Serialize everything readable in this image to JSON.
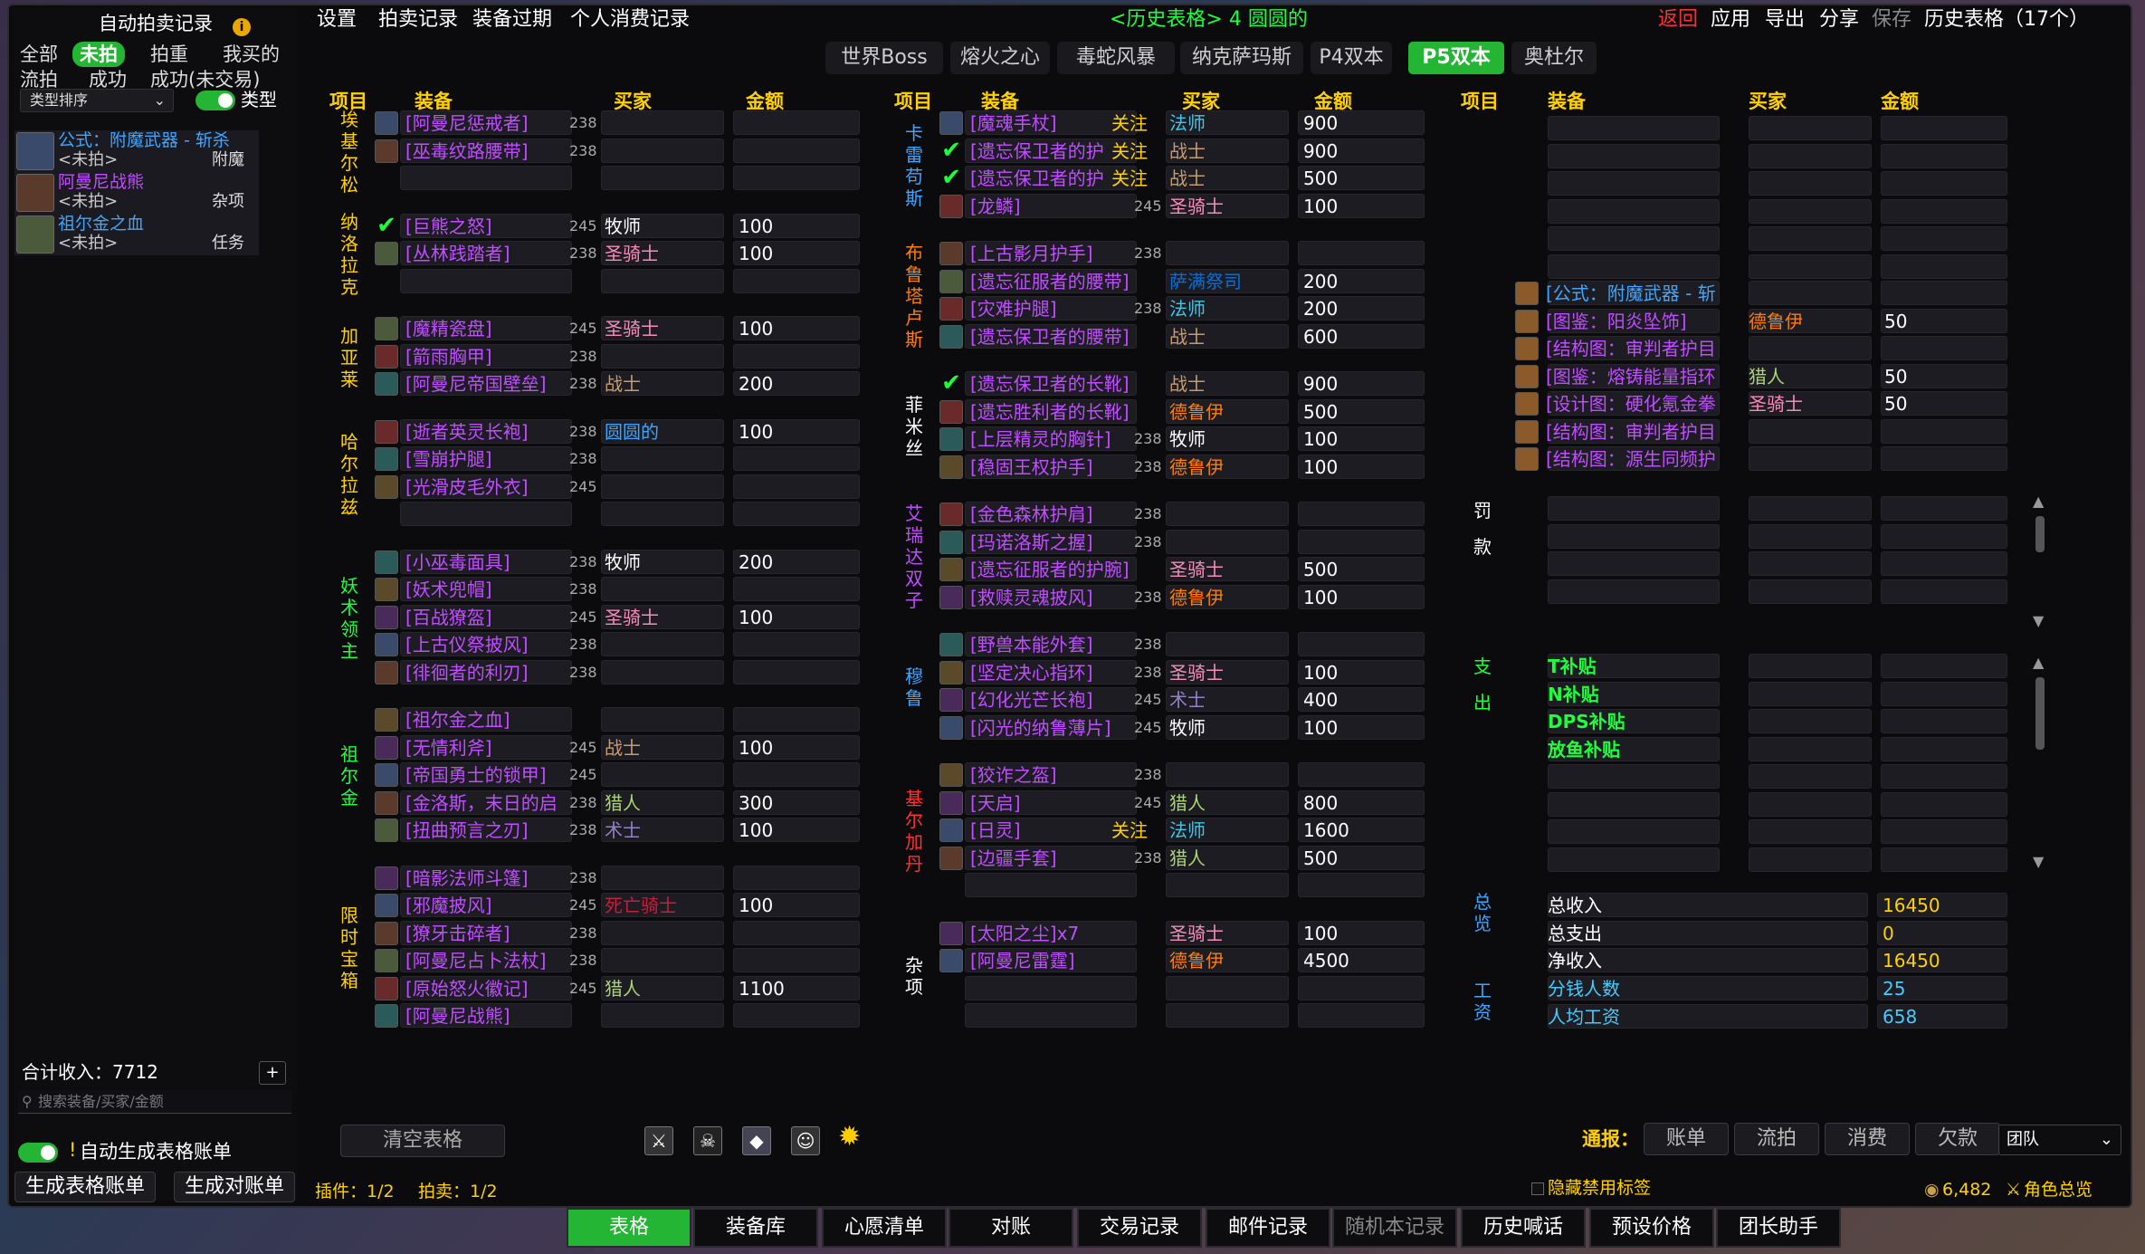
{
  "left": {
    "title": "自动拍卖记录",
    "filters1": [
      "全部",
      "未拍",
      "拍重",
      "我买的"
    ],
    "filters2": [
      "流拍",
      "成功",
      "成功(未交易)"
    ],
    "sort": "类型排序",
    "type_label": "类型",
    "items": [
      {
        "name": "公式：附魔武器 - 斩杀",
        "status": "<未拍>",
        "cat": "附魔",
        "color": "blue"
      },
      {
        "name": "阿曼尼战熊",
        "status": "<未拍>",
        "cat": "杂项",
        "color": "purple"
      },
      {
        "name": "祖尔金之血",
        "status": "<未拍>",
        "cat": "任务",
        "color": "blue"
      }
    ],
    "total": "合计收入：7712",
    "search_placeholder": "搜索装备/买家/金额",
    "auto_label": "自动生成表格账单",
    "gen_table": "生成表格账单",
    "gen_bill": "生成对账单"
  },
  "menu": {
    "items": [
      "设置",
      "拍卖记录",
      "装备过期",
      "个人消费记录"
    ],
    "center": "<历史表格> 4 圆圆的",
    "right": [
      "返回",
      "应用",
      "导出",
      "分享",
      "保存",
      "历史表格（17个）"
    ]
  },
  "tabs": [
    "世界Boss",
    "熔火之心",
    "毒蛇风暴",
    "纳克萨玛斯",
    "P4双本",
    "P5双本",
    "奥杜尔"
  ],
  "headers": [
    "项目",
    "装备",
    "买家",
    "金额"
  ],
  "col1": [
    {
      "boss": "埃基尔松",
      "rows": [
        {
          "item": "[阿曼尼惩戒者]",
          "ilv": "238",
          "buyer": "",
          "amount": ""
        },
        {
          "item": "[巫毒纹路腰带]",
          "ilv": "238",
          "buyer": "",
          "amount": ""
        },
        {
          "item": "",
          "ilv": "",
          "buyer": "",
          "amount": ""
        }
      ]
    },
    {
      "boss": "纳洛拉克",
      "rows": [
        {
          "item": "[巨熊之怒]",
          "ilv": "245",
          "buyer": "牧师",
          "amount": "100",
          "check": true
        },
        {
          "item": "[丛林践踏者]",
          "ilv": "238",
          "buyer": "圣骑士",
          "amount": "100"
        },
        {
          "item": "",
          "ilv": "",
          "buyer": "",
          "amount": ""
        }
      ]
    },
    {
      "boss": "加亚莱",
      "rows": [
        {
          "item": "[魔精瓷盘]",
          "ilv": "245",
          "buyer": "圣骑士",
          "amount": "100"
        },
        {
          "item": "[箭雨胸甲]",
          "ilv": "238",
          "buyer": "",
          "amount": ""
        },
        {
          "item": "[阿曼尼帝国壁垒]",
          "ilv": "238",
          "buyer": "战士",
          "amount": "200"
        }
      ]
    },
    {
      "boss": "哈尔拉兹",
      "rows": [
        {
          "item": "[逝者英灵长袍]",
          "ilv": "238",
          "buyer": "圆圆的",
          "amount": "100"
        },
        {
          "item": "[雪崩护腿]",
          "ilv": "238",
          "buyer": "",
          "amount": ""
        },
        {
          "item": "[光滑皮毛外衣]",
          "ilv": "245",
          "buyer": "",
          "amount": ""
        },
        {
          "item": "",
          "ilv": "",
          "buyer": "",
          "amount": ""
        }
      ]
    },
    {
      "boss": "妖术领主",
      "rows": [
        {
          "item": "[小巫毒面具]",
          "ilv": "238",
          "buyer": "牧师",
          "amount": "200"
        },
        {
          "item": "[妖术兜帽]",
          "ilv": "238",
          "buyer": "",
          "amount": ""
        },
        {
          "item": "[百战獠盔]",
          "ilv": "245",
          "buyer": "圣骑士",
          "amount": "100"
        },
        {
          "item": "[上古仪祭披风]",
          "ilv": "238",
          "buyer": "",
          "amount": ""
        },
        {
          "item": "[徘徊者的利刃]",
          "ilv": "238",
          "buyer": "",
          "amount": ""
        }
      ]
    },
    {
      "boss": "祖尔金",
      "rows": [
        {
          "item": "[祖尔金之血]",
          "ilv": "",
          "buyer": "",
          "amount": ""
        },
        {
          "item": "[无情利斧]",
          "ilv": "245",
          "buyer": "战士",
          "amount": "100"
        },
        {
          "item": "[帝国勇士的锁甲]",
          "ilv": "245",
          "buyer": "",
          "amount": ""
        },
        {
          "item": "[金洛斯，末日的启",
          "ilv": "238",
          "buyer": "猎人",
          "amount": "300"
        },
        {
          "item": "[扭曲预言之刃]",
          "ilv": "238",
          "buyer": "术士",
          "amount": "100"
        }
      ]
    },
    {
      "boss": "限时宝箱",
      "rows": [
        {
          "item": "[暗影法师斗篷]",
          "ilv": "238",
          "buyer": "",
          "amount": ""
        },
        {
          "item": "[邪魔披风]",
          "ilv": "245",
          "buyer": "死亡骑士",
          "amount": "100"
        },
        {
          "item": "[獠牙击碎者]",
          "ilv": "238",
          "buyer": "",
          "amount": ""
        },
        {
          "item": "[阿曼尼占卜法杖]",
          "ilv": "238",
          "buyer": "",
          "amount": ""
        },
        {
          "item": "[原始怒火徽记]",
          "ilv": "245",
          "buyer": "猎人",
          "amount": "1100"
        },
        {
          "item": "[阿曼尼战熊]",
          "ilv": "",
          "buyer": "",
          "amount": ""
        }
      ]
    }
  ],
  "col2": [
    {
      "boss": "卡雷苟斯",
      "rows": [
        {
          "item": "[魔魂手杖]",
          "ilv": "",
          "follow": "关注",
          "buyer": "法师",
          "amount": "900"
        },
        {
          "item": "[遗忘保卫者的护",
          "ilv": "",
          "follow": "关注",
          "buyer": "战士",
          "amount": "900",
          "check": true
        },
        {
          "item": "[遗忘保卫者的护",
          "ilv": "",
          "follow": "关注",
          "buyer": "战士",
          "amount": "500",
          "check": true
        },
        {
          "item": "[龙鳞]",
          "ilv": "245",
          "buyer": "圣骑士",
          "amount": "100"
        }
      ]
    },
    {
      "boss": "布鲁塔卢斯",
      "rows": [
        {
          "item": "[上古影月护手]",
          "ilv": "238",
          "buyer": "",
          "amount": ""
        },
        {
          "item": "[遗忘征服者的腰带]",
          "ilv": "",
          "buyer": "萨满祭司",
          "amount": "200"
        },
        {
          "item": "[灾难护腿]",
          "ilv": "238",
          "buyer": "法师",
          "amount": "200"
        },
        {
          "item": "[遗忘保卫者的腰带]",
          "ilv": "",
          "buyer": "战士",
          "amount": "600"
        }
      ]
    },
    {
      "boss": "菲米丝",
      "rows": [
        {
          "item": "[遗忘保卫者的长靴]",
          "ilv": "",
          "buyer": "战士",
          "amount": "900",
          "check": true
        },
        {
          "item": "[遗忘胜利者的长靴]",
          "ilv": "",
          "buyer": "德鲁伊",
          "amount": "500"
        },
        {
          "item": "[上层精灵的胸针]",
          "ilv": "238",
          "buyer": "牧师",
          "amount": "100"
        },
        {
          "item": "[稳固王权护手]",
          "ilv": "238",
          "buyer": "德鲁伊",
          "amount": "100"
        }
      ]
    },
    {
      "boss": "艾瑞达双子",
      "rows": [
        {
          "item": "[金色森林护肩]",
          "ilv": "238",
          "buyer": "",
          "amount": ""
        },
        {
          "item": "[玛诺洛斯之握]",
          "ilv": "238",
          "buyer": "",
          "amount": ""
        },
        {
          "item": "[遗忘征服者的护腕]",
          "ilv": "",
          "buyer": "圣骑士",
          "amount": "500"
        },
        {
          "item": "[救赎灵魂披风]",
          "ilv": "238",
          "buyer": "德鲁伊",
          "amount": "100"
        }
      ]
    },
    {
      "boss": "穆鲁",
      "rows": [
        {
          "item": "[野兽本能外套]",
          "ilv": "238",
          "buyer": "",
          "amount": ""
        },
        {
          "item": "[坚定决心指环]",
          "ilv": "238",
          "buyer": "圣骑士",
          "amount": "100"
        },
        {
          "item": "[幻化光芒长袍]",
          "ilv": "245",
          "buyer": "术士",
          "amount": "400"
        },
        {
          "item": "[闪光的纳鲁薄片]",
          "ilv": "245",
          "buyer": "牧师",
          "amount": "100"
        }
      ]
    },
    {
      "boss": "基尔加丹",
      "rows": [
        {
          "item": "[狡诈之盔]",
          "ilv": "238",
          "buyer": "",
          "amount": ""
        },
        {
          "item": "[天启]",
          "ilv": "245",
          "buyer": "猎人",
          "amount": "800"
        },
        {
          "item": "[日灵]",
          "ilv": "",
          "follow": "关注",
          "buyer": "法师",
          "amount": "1600"
        },
        {
          "item": "[边疆手套]",
          "ilv": "238",
          "buyer": "猎人",
          "amount": "500"
        },
        {
          "item": "",
          "ilv": "",
          "buyer": "",
          "amount": ""
        }
      ]
    },
    {
      "boss": "杂项",
      "rows": [
        {
          "item": "[太阳之尘]x7",
          "ilv": "",
          "buyer": "圣骑士",
          "amount": "100"
        },
        {
          "item": "[阿曼尼雷霆]",
          "ilv": "",
          "buyer": "德鲁伊",
          "amount": "4500"
        },
        {
          "item": "",
          "ilv": "",
          "buyer": "",
          "amount": ""
        },
        {
          "item": "",
          "ilv": "",
          "buyer": "",
          "amount": ""
        }
      ]
    }
  ],
  "col3": {
    "misc": [
      {
        "item": "[公式：附魔武器 - 斩",
        "buyer": "",
        "amount": ""
      },
      {
        "item": "[图鉴：阳炎坠饰]",
        "buyer": "德鲁伊",
        "amount": "50"
      },
      {
        "item": "[结构图：审判者护目",
        "buyer": "",
        "amount": ""
      },
      {
        "item": "[图鉴：熔铸能量指环",
        "buyer": "猎人",
        "amount": "50"
      },
      {
        "item": "[设计图：硬化氪金拳",
        "buyer": "圣骑士",
        "amount": "50"
      },
      {
        "item": "[结构图：审判者护目",
        "buyer": "",
        "amount": ""
      },
      {
        "item": "[结构图：源生同频护",
        "buyer": "",
        "amount": ""
      }
    ],
    "penalty_label": "罚款",
    "expense_label": "支出",
    "expense": [
      "T补贴",
      "N补贴",
      "DPS补贴",
      "放鱼补贴"
    ],
    "summary_label": "总览",
    "summary": [
      {
        "k": "总收入",
        "v": "16450"
      },
      {
        "k": "总支出",
        "v": "0"
      },
      {
        "k": "净收入",
        "v": "16450"
      }
    ],
    "wage_label": "工资",
    "wage": [
      {
        "k": "分钱人数",
        "v": "25"
      },
      {
        "k": "人均工资",
        "v": "658"
      }
    ]
  },
  "footer": {
    "clear": "清空表格",
    "plugin": "插件：1/2",
    "auction": "拍卖：1/2",
    "notify": "通报：",
    "notify_btns": [
      "账单",
      "流拍",
      "消费",
      "欠款"
    ],
    "channel": "团队",
    "hide": "隐藏禁用标签",
    "gold": "6,482",
    "overview": "角色总览"
  },
  "bottom_tabs": [
    "表格",
    "装备库",
    "心愿清单",
    "对账",
    "交易记录",
    "邮件记录",
    "随机本记录",
    "历史喊话",
    "预设价格",
    "团长助手"
  ]
}
